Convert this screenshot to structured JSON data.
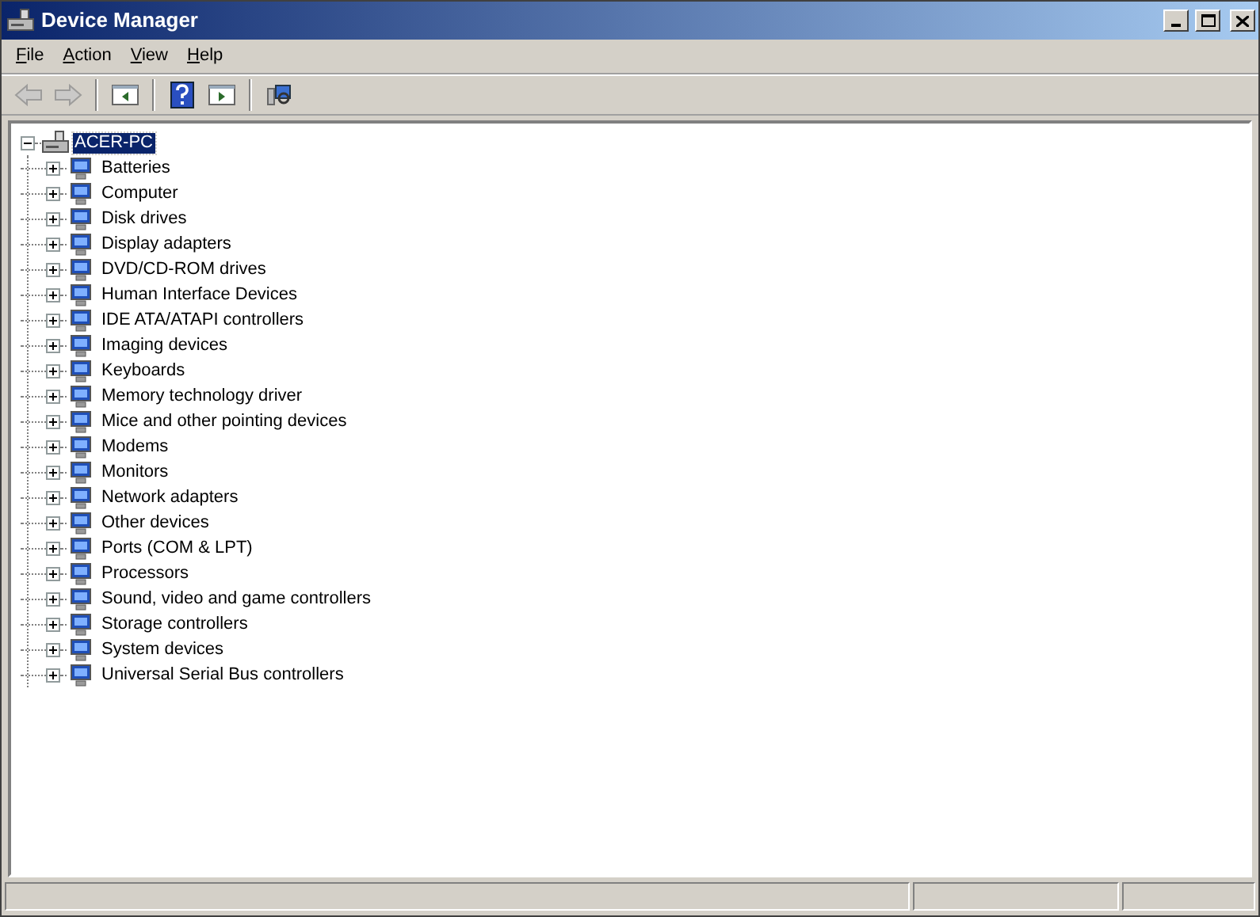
{
  "window": {
    "title": "Device Manager"
  },
  "menu": [
    {
      "label": "File"
    },
    {
      "label": "Action"
    },
    {
      "label": "View"
    },
    {
      "label": "Help"
    }
  ],
  "toolbar": [
    {
      "kind": "back",
      "disabled": true
    },
    {
      "kind": "forward",
      "disabled": true
    },
    {
      "kind": "separator"
    },
    {
      "kind": "tree",
      "disabled": false
    },
    {
      "kind": "separator"
    },
    {
      "kind": "help",
      "disabled": false
    },
    {
      "kind": "pane",
      "disabled": false
    },
    {
      "kind": "separator"
    },
    {
      "kind": "scan",
      "disabled": false
    }
  ],
  "tree": {
    "label": "ACER-PC",
    "selected": true,
    "expanded": true,
    "children": [
      {
        "label": "Batteries",
        "expanded": false
      },
      {
        "label": "Computer",
        "expanded": false
      },
      {
        "label": "Disk drives",
        "expanded": false
      },
      {
        "label": "Display adapters",
        "expanded": false
      },
      {
        "label": "DVD/CD-ROM drives",
        "expanded": false
      },
      {
        "label": "Human Interface Devices",
        "expanded": false
      },
      {
        "label": "IDE ATA/ATAPI controllers",
        "expanded": false
      },
      {
        "label": "Imaging devices",
        "expanded": false
      },
      {
        "label": "Keyboards",
        "expanded": false
      },
      {
        "label": "Memory technology driver",
        "expanded": false
      },
      {
        "label": "Mice and other pointing devices",
        "expanded": false
      },
      {
        "label": "Modems",
        "expanded": false
      },
      {
        "label": "Monitors",
        "expanded": false
      },
      {
        "label": "Network adapters",
        "expanded": false
      },
      {
        "label": "Other devices",
        "expanded": false
      },
      {
        "label": "Ports (COM & LPT)",
        "expanded": false
      },
      {
        "label": "Processors",
        "expanded": false
      },
      {
        "label": "Sound, video and game controllers",
        "expanded": false
      },
      {
        "label": "Storage controllers",
        "expanded": false
      },
      {
        "label": "System devices",
        "expanded": false
      },
      {
        "label": "Universal Serial Bus controllers",
        "expanded": false
      }
    ]
  }
}
